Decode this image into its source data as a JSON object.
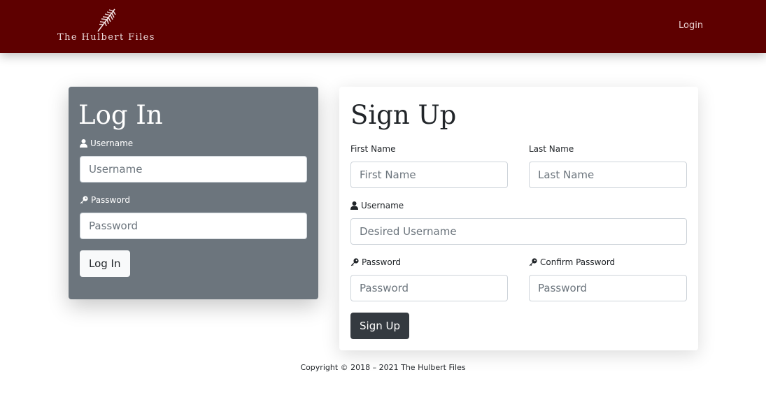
{
  "navbar": {
    "brand": "The Hulbert Files",
    "login_link": "Login",
    "background_color": "#5e0000",
    "logo_icon": "feather-icon"
  },
  "login_card": {
    "title": "Log In",
    "username_label": "Username",
    "username_placeholder": "Username",
    "password_label": "Password",
    "password_placeholder": "Password",
    "submit_label": "Log In",
    "background_color": "#6c757d"
  },
  "signup_card": {
    "title": "Sign Up",
    "first_name_label": "First Name",
    "first_name_placeholder": "First Name",
    "last_name_label": "Last Name",
    "last_name_placeholder": "Last Name",
    "username_label": "Username",
    "username_placeholder": "Desired Username",
    "password_label": "Password",
    "password_placeholder": "Password",
    "confirm_password_label": "Confirm Password",
    "confirm_password_placeholder": "Password",
    "submit_label": "Sign Up",
    "button_color": "#343a40"
  },
  "footer": {
    "copyright": "Copyright © 2018 – 2021 The Hulbert Files"
  }
}
